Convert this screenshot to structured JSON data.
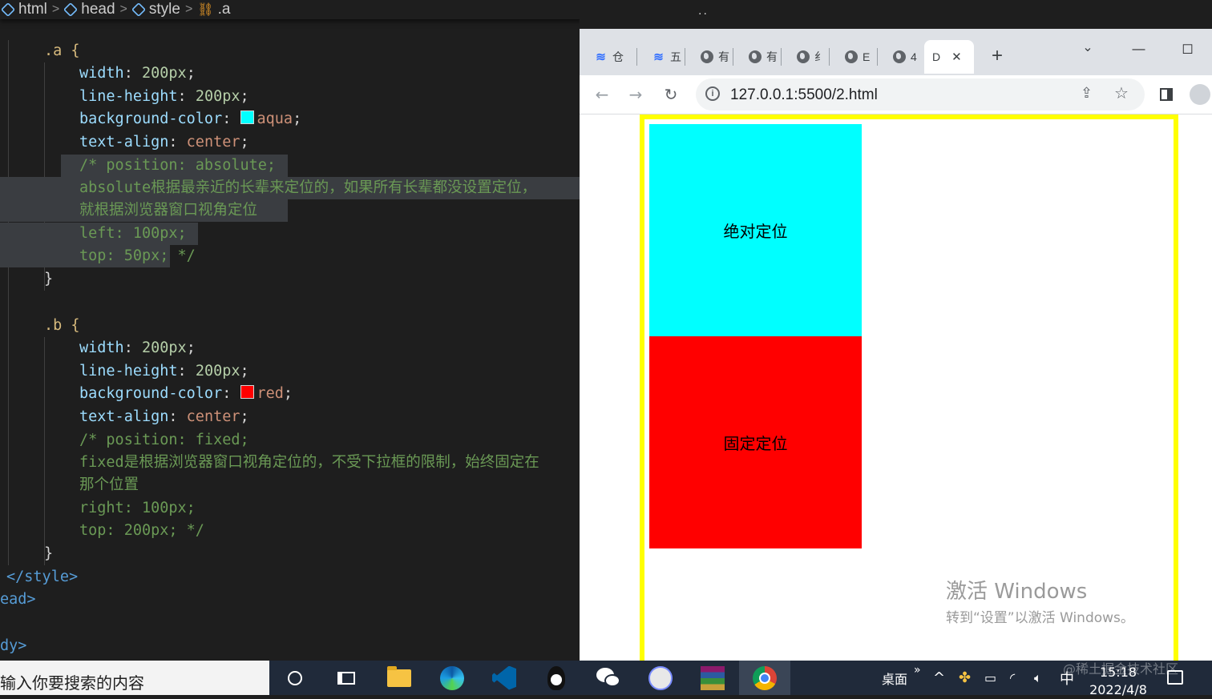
{
  "editor": {
    "breadcrumb": [
      {
        "label": "html",
        "icon": "cube-icon"
      },
      {
        "label": "head",
        "icon": "cube-icon"
      },
      {
        "label": "style",
        "icon": "cube-icon"
      },
      {
        "label": ".a",
        "icon": "selector-icon"
      }
    ],
    "a": {
      "selector": ".a {",
      "width_prop": "width",
      "width_val": "200px",
      "lh_prop": "line-height",
      "lh_val": "200px",
      "bg_prop": "background-color",
      "bg_val": "aqua",
      "bg_color": "#00ffff",
      "ta_prop": "text-align",
      "ta_val": "center",
      "c1": "/* position: absolute;",
      "c2": "absolute根据最亲近的长辈来定位的，如果所有长辈都没设置定位，",
      "c3": "就根据浏览器窗口视角定位",
      "c4": "left: 100px;",
      "c5": "top: 50px;",
      "c5_end": " */",
      "close": "}"
    },
    "b": {
      "selector": ".b {",
      "width_prop": "width",
      "width_val": "200px",
      "lh_prop": "line-height",
      "lh_val": "200px",
      "bg_prop": "background-color",
      "bg_val": "red",
      "bg_color": "#ff0000",
      "ta_prop": "text-align",
      "ta_val": "center",
      "c1": "/* position: fixed;",
      "c2": "fixed是根据浏览器窗口视角定位的，不受下拉框的限制，始终固定在",
      "c3": "那个位置",
      "c4": "right: 100px;",
      "c5": "top: 200px; */",
      "close": "}"
    },
    "tail": {
      "style_close": "</style>",
      "head_close": "ead>",
      "body_frag": "dy>"
    }
  },
  "browser": {
    "tabs": [
      {
        "label": "仓",
        "icon": "lark-icon"
      },
      {
        "label": "五",
        "icon": "lark-icon"
      },
      {
        "label": "有",
        "icon": "globe-icon"
      },
      {
        "label": "有",
        "icon": "globe-icon"
      },
      {
        "label": "纟",
        "icon": "globe-icon"
      },
      {
        "label": "E",
        "icon": "globe-icon"
      },
      {
        "label": "4",
        "icon": "globe-icon"
      }
    ],
    "active_tab": {
      "label": "D",
      "close": "✕"
    },
    "new_tab": "+",
    "tab_search": "⌄",
    "window": {
      "minimize": "—",
      "maximize": "☐"
    },
    "url": "127.0.0.1:5500/2.html",
    "page": {
      "box_a_text": "绝对定位",
      "box_b_text": "固定定位",
      "colors": {
        "border": "#ffff00",
        "a": "#00ffff",
        "b": "#ff0000"
      }
    },
    "activation": {
      "line1": "激活 Windows",
      "line2": "转到“设置”以激活 Windows。"
    }
  },
  "taskbar": {
    "search_placeholder": "输入你要搜索的内容",
    "desktop_label": "桌面",
    "more": "»",
    "ime": "中",
    "time": "15:18",
    "date": "2022/4/8",
    "watermark": "@稀土掘金技术社区"
  }
}
